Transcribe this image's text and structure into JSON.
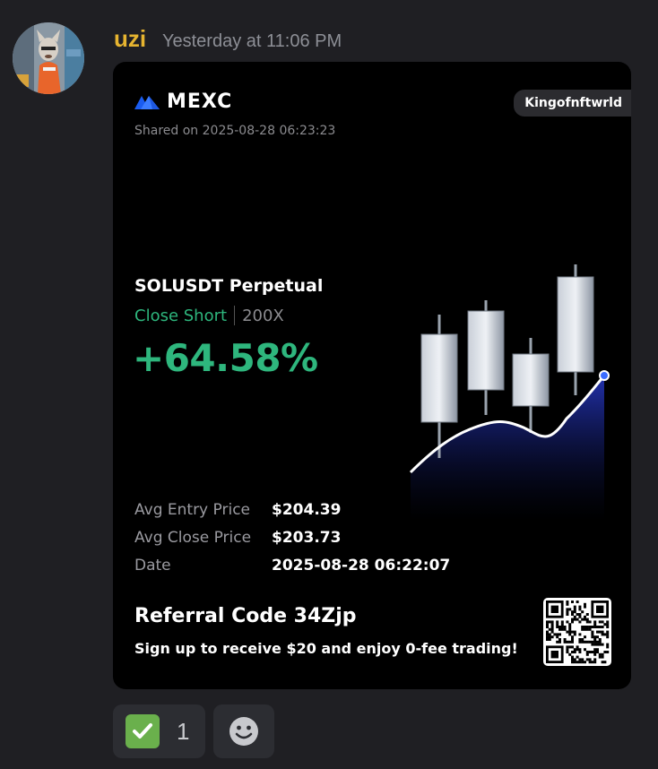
{
  "message": {
    "author": "uzi",
    "timestamp": "Yesterday at 11:06 PM"
  },
  "card": {
    "brand": "MEXC",
    "shared_on": "Shared on 2025-08-28 06:23:23",
    "user_tag": "Kingofnftwrld",
    "pair": "SOLUSDT Perpetual",
    "action": "Close Short",
    "leverage": "200X",
    "roi": "+64.58%",
    "stats": [
      {
        "label": "Avg Entry Price",
        "value": "$204.39"
      },
      {
        "label": "Avg Close Price",
        "value": "$203.73"
      },
      {
        "label": "Date",
        "value": "2025-08-28 06:22:07"
      }
    ],
    "referral": "Referral Code 34Zjp",
    "signup_text": "Sign up to receive $20 and enjoy 0-fee trading!"
  },
  "reactions": [
    {
      "icon": "check-mark-icon",
      "count": "1"
    },
    {
      "icon": "add-reaction-icon"
    }
  ],
  "colors": {
    "author": "#e6b430",
    "profit_green": "#2eb67d",
    "brand_blue": "#1a5cf0",
    "card_bg": "#000000",
    "page_bg": "#1f1f23"
  }
}
